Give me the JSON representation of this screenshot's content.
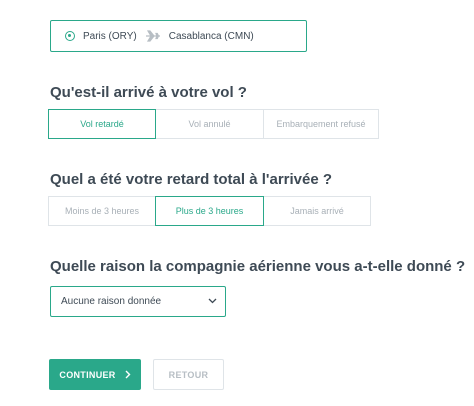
{
  "route": {
    "origin": "Paris (ORY)",
    "destination": "Casablanca (CMN)"
  },
  "q1": {
    "question": "Qu'est-il arrivé à votre vol ?",
    "options": [
      "Vol retardé",
      "Vol annulé",
      "Embarquement refusé"
    ],
    "selected": "Vol retardé"
  },
  "q2": {
    "question": "Quel a été votre retard total à l'arrivée ?",
    "options": [
      "Moins de 3 heures",
      "Plus de 3 heures",
      "Jamais arrivé"
    ],
    "selected": "Plus de 3 heures"
  },
  "q3": {
    "question": "Quelle raison la compagnie aérienne vous a-t-elle donné ?",
    "selected": "Aucune raison donnée"
  },
  "actions": {
    "continue_label": "CONTINUER",
    "back_label": "RETOUR"
  },
  "colors": {
    "accent": "#2aa88a",
    "border": "#dfe4e8",
    "text": "#3e4a55",
    "muted": "#a8b0b7"
  }
}
